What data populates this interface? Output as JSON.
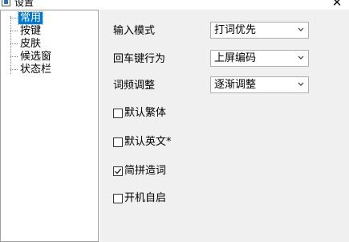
{
  "window": {
    "title": "设置",
    "close_glyph": "✕"
  },
  "tree": {
    "items": [
      {
        "label": "常用",
        "selected": true
      },
      {
        "label": "按键",
        "selected": false
      },
      {
        "label": "皮肤",
        "selected": false
      },
      {
        "label": "候选窗",
        "selected": false
      },
      {
        "label": "状态栏",
        "selected": false
      }
    ]
  },
  "settings": {
    "input_mode": {
      "label": "输入模式",
      "value": "打词优先"
    },
    "enter_key": {
      "label": "回车键行为",
      "value": "上屏编码"
    },
    "freq_adjust": {
      "label": "词频调整",
      "value": "逐渐调整"
    },
    "checkboxes": [
      {
        "label": "默认繁体",
        "checked": false
      },
      {
        "label": "默认英文*",
        "checked": false
      },
      {
        "label": "简拼造词",
        "checked": true
      },
      {
        "label": "开机自启",
        "checked": false
      }
    ]
  },
  "icons": {
    "app": "settings-window-icon",
    "dropdown": "chevron-down-icon",
    "check": "checkmark-icon"
  },
  "colors": {
    "selection": "#0078d7",
    "panel_bg": "#f0f0f0",
    "border": "#adadad"
  }
}
